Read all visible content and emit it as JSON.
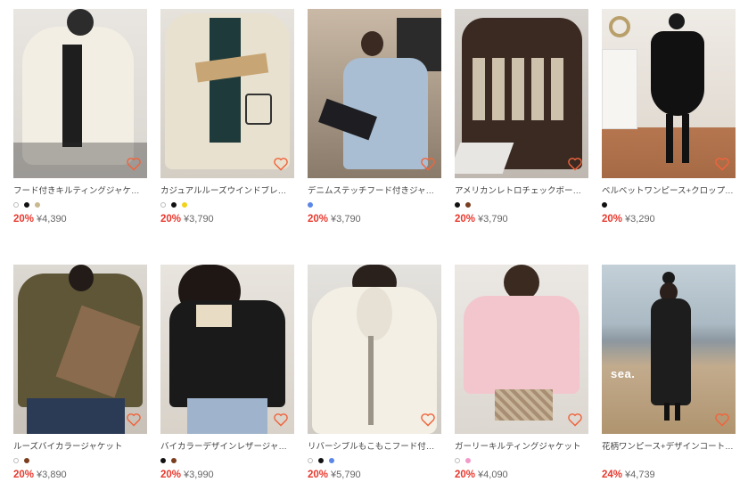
{
  "products": [
    {
      "title": "フード付きキルティングジャケット",
      "discount": "20%",
      "price": "¥4,390",
      "swatches": [
        "#ffffff",
        "#111111",
        "#c8b98f"
      ]
    },
    {
      "title": "カジュアルルーズウインドブレーカー",
      "discount": "20%",
      "price": "¥3,790",
      "swatches": [
        "#ffffff",
        "#111111",
        "#f2d21b"
      ]
    },
    {
      "title": "デニムステッチフード付きジャケット",
      "discount": "20%",
      "price": "¥3,790",
      "swatches": [
        "#5a86e8"
      ]
    },
    {
      "title": "アメリカンレトロチェックボーイフレンドジャケット",
      "discount": "20%",
      "price": "¥3,790",
      "swatches": [
        "#111111",
        "#7a3e1e"
      ]
    },
    {
      "title": "ベルベットワンピース+クロップドジャケット",
      "discount": "20%",
      "price": "¥3,290",
      "swatches": [
        "#111111"
      ]
    },
    {
      "title": "ルーズバイカラージャケット",
      "discount": "20%",
      "price": "¥3,890",
      "swatches": [
        "#ffffff",
        "#7a3e1e"
      ]
    },
    {
      "title": "バイカラーデザインレザージャケット",
      "discount": "20%",
      "price": "¥3,990",
      "swatches": [
        "#111111",
        "#7a3e1e"
      ]
    },
    {
      "title": "リバーシブルもこもこフード付きジャケット",
      "discount": "20%",
      "price": "¥5,790",
      "swatches": [
        "#ffffff",
        "#111111",
        "#5a86e8"
      ]
    },
    {
      "title": "ガーリーキルティングジャケット",
      "discount": "20%",
      "price": "¥4,090",
      "swatches": [
        "#ffffff",
        "#f29ac9"
      ]
    },
    {
      "title": "花柄ワンピース+デザインコートセット",
      "discount": "24%",
      "price": "¥4,739",
      "swatches": []
    }
  ],
  "overlay_text": {
    "sea": "sea."
  },
  "colors": {
    "discount": "#e8392e",
    "heart": "#f0643c"
  },
  "icons": {
    "favorite": "heart-outline-icon"
  }
}
